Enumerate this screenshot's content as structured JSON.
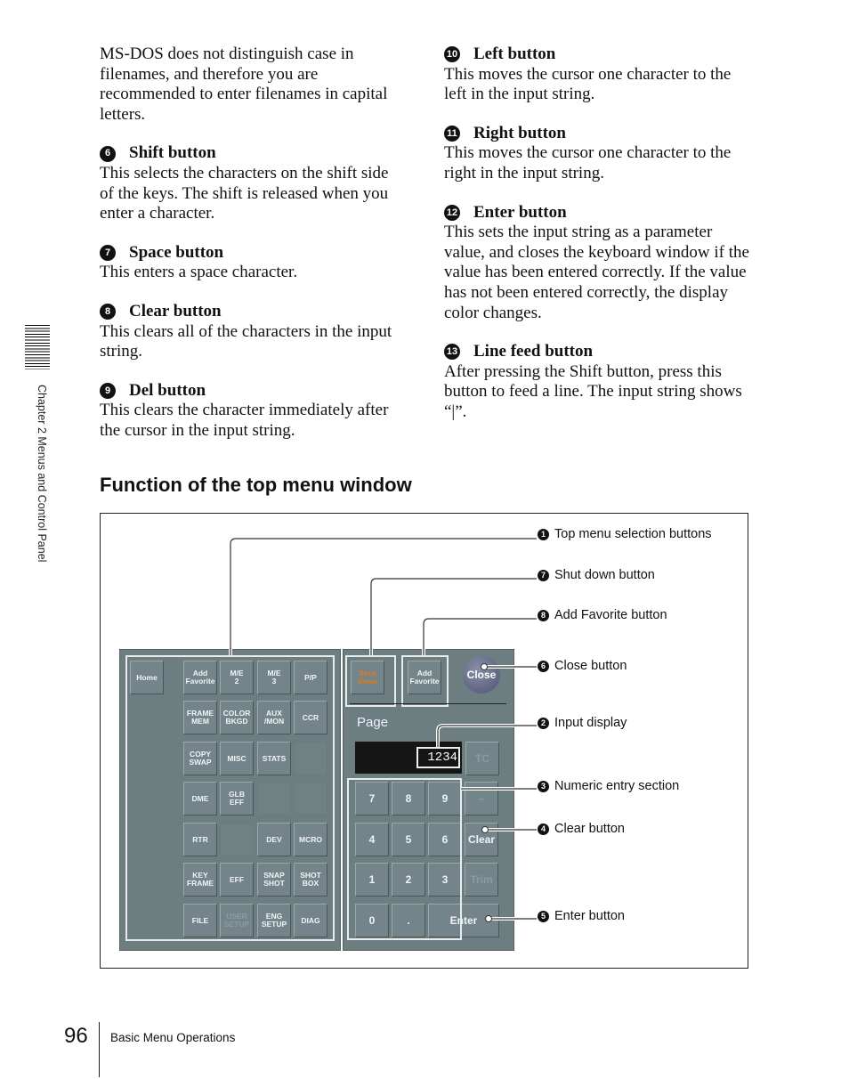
{
  "left_column": {
    "intro": "MS-DOS does not distinguish case in filenames, and therefore you are recommended to enter filenames in capital letters.",
    "items": [
      {
        "num": "6",
        "title": "Shift button",
        "text": "This selects the characters on the shift side of the keys. The shift is released when you enter a character."
      },
      {
        "num": "7",
        "title": "Space button",
        "text": "This enters a space character."
      },
      {
        "num": "8",
        "title": "Clear button",
        "text": "This clears all of the characters in the input string."
      },
      {
        "num": "9",
        "title": "Del button",
        "text": "This clears the character immediately after the cursor in the input string."
      }
    ]
  },
  "right_column": {
    "items": [
      {
        "num": "10",
        "title": "Left button",
        "text": "This moves the cursor one character to the left in the input string."
      },
      {
        "num": "11",
        "title": "Right button",
        "text": "This moves the cursor one character to the right in the input string."
      },
      {
        "num": "12",
        "title": "Enter button",
        "text": "This sets the input string as a parameter value, and closes the keyboard window if the value has been entered correctly. If the value has not been entered correctly, the display color changes."
      },
      {
        "num": "13",
        "title": "Line feed button",
        "text": "After pressing the Shift button, press this button to feed a line. The input string shows “|”."
      }
    ]
  },
  "section_title": "Function of the top menu window",
  "panel": {
    "home": "Home",
    "menu_rows": [
      [
        "Add\nFavorite",
        "M/E\n2",
        "M/E\n3",
        "P/P"
      ],
      [
        "FRAME\nMEM",
        "COLOR\nBKGD",
        "AUX\n/MON",
        "CCR"
      ],
      [
        "COPY\nSWAP",
        "MISC",
        "STATS",
        ""
      ],
      [
        "DME",
        "GLB\nEFF",
        "",
        ""
      ],
      [
        "RTR",
        "",
        "DEV",
        "MCRO"
      ],
      [
        "KEY\nFRAME",
        "EFF",
        "SNAP\nSHOT",
        "SHOT\nBOX"
      ],
      [
        "FILE",
        "USER\nSETUP",
        "ENG\nSETUP",
        "DIAG"
      ]
    ],
    "disabled": [
      "USER\nSETUP"
    ],
    "shut_down": "Shut\ndown",
    "shut_down_color": "#e07a1a",
    "add_favorite": "Add\nFavorite",
    "close": "Close",
    "page_label": "Page",
    "input_value": "1234",
    "tc": "TC",
    "keypad_rows": [
      [
        "7",
        "8",
        "9",
        "–"
      ],
      [
        "4",
        "5",
        "6",
        "Clear"
      ],
      [
        "1",
        "2",
        "3",
        "Trim"
      ],
      [
        "0",
        "."
      ]
    ],
    "enter": "Enter"
  },
  "callouts": [
    {
      "num": "1",
      "label": "Top menu selection buttons"
    },
    {
      "num": "7",
      "label": "Shut down button"
    },
    {
      "num": "8",
      "label": "Add Favorite button"
    },
    {
      "num": "6",
      "label": "Close button"
    },
    {
      "num": "2",
      "label": "Input display"
    },
    {
      "num": "3",
      "label": "Numeric entry section"
    },
    {
      "num": "4",
      "label": "Clear button"
    },
    {
      "num": "5",
      "label": "Enter button"
    }
  ],
  "sidebar": {
    "chapter": "Chapter 2  Menus and Control Panel"
  },
  "footer": {
    "page_number": "96",
    "section": "Basic Menu Operations"
  }
}
